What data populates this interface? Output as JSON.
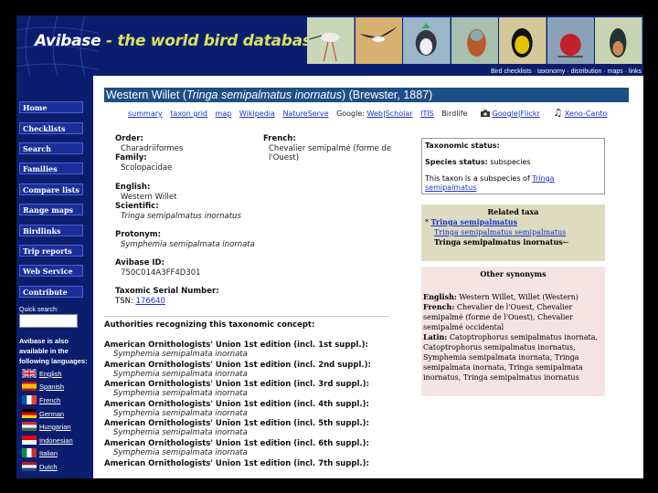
{
  "header": {
    "brand": "Avibase",
    "separator": " - ",
    "tagline": "the world bird database",
    "links": "Bird checklists · taxonomy · distribution · maps · links",
    "bird_colors": [
      "#c9d6b8",
      "#d8b070",
      "#9ab6c8",
      "#a8c0b0",
      "#d4c89a",
      "#8aa2b8",
      "#c8d4b0",
      "#b8c8d8"
    ]
  },
  "sidebar": {
    "nav": [
      "Home",
      "Checklists",
      "Search",
      "Families",
      "Compare lists",
      "Range maps",
      "Birdlinks",
      "Trip reports",
      "Web Service",
      "Contribute"
    ],
    "quick_search_label": "Quick search:",
    "quick_search_value": "",
    "available_text": "Avibase is also available in the following languages:",
    "languages": [
      {
        "name": "English",
        "flag": "uk"
      },
      {
        "name": "Spanish",
        "flag": "es"
      },
      {
        "name": "French",
        "flag": "fr"
      },
      {
        "name": "German",
        "flag": "de"
      },
      {
        "name": "Hungarian",
        "flag": "hu"
      },
      {
        "name": "Indonesian",
        "flag": "id"
      },
      {
        "name": "Italian",
        "flag": "it"
      },
      {
        "name": "Dutch",
        "flag": "nl"
      }
    ]
  },
  "title": {
    "prefix": "Western Willet (",
    "sci": "Tringa semipalmatus inornatus",
    "suffix": ") (Brewster, 1887)"
  },
  "tabs": {
    "summary": "summary",
    "taxon_grid": "taxon grid",
    "map": "map",
    "wikipedia": "Wikipedia",
    "natureserve": "NatureServe",
    "google_label": "Google:",
    "web": "Web",
    "pipe": "|",
    "scholar": "Scholar",
    "itis": "ITIS",
    "birdlife": "Birdlife",
    "google": "Google",
    "flickr": "Flickr",
    "xeno": "Xeno-Canto"
  },
  "info": {
    "order_label": "Order:",
    "order": "Charadriiformes",
    "family_label": "Family:",
    "family": "Scolopacidae",
    "english_label": "English:",
    "english": "Western Willet",
    "scientific_label": "Scientific:",
    "scientific": "Tringa semipalmatus inornatus",
    "protonym_label": "Protonym:",
    "protonym": "Symphemia semipalmata inornata",
    "avibase_id_label": "Avibase ID:",
    "avibase_id": "750C014A3FF4D301",
    "tsn_label": "Taxomic Serial Number:",
    "tsn_prefix": "TSN:",
    "tsn": "176640",
    "french_label": "French:",
    "french": "Chevalier semipalmé (forme de l'Ouest)"
  },
  "authorities": {
    "title": "Authorities recognizing this taxonomic concept:",
    "rows": [
      {
        "name": "American Ornithologists' Union 1st edition (incl. 1st suppl.):",
        "species": "Symphemia semipalmata inornata"
      },
      {
        "name": "American Ornithologists' Union 1st edition (incl. 2nd suppl.):",
        "species": "Symphemia semipalmata inornata"
      },
      {
        "name": "American Ornithologists' Union 1st edition (incl. 3rd suppl.):",
        "species": "Symphemia semipalmata inornata"
      },
      {
        "name": "American Ornithologists' Union 1st edition (incl. 4th suppl.):",
        "species": "Symphemia semipalmata inornata"
      },
      {
        "name": "American Ornithologists' Union 1st edition (incl. 5th suppl.):",
        "species": "Symphemia semipalmata inornata"
      },
      {
        "name": "American Ornithologists' Union 1st edition (incl. 6th suppl.):",
        "species": "Symphemia semipalmata inornata"
      },
      {
        "name": "American Ornithologists' Union 1st edition (incl. 7th suppl.):",
        "species": ""
      }
    ]
  },
  "taxonomic": {
    "status_label": "Taxonomic status:",
    "species_status_label": "Species status:",
    "species_status": "subspecies",
    "subspecies_text": "This taxon is a subspecies of ",
    "parent_link": "Tringa semipalmatus"
  },
  "related": {
    "title": "Related taxa",
    "bullet": "*",
    "item1": "Tringa semipalmatus",
    "item2": "Tringa semipalmatus semipalmatus",
    "item3": "Tringa semipalmatus inornatus",
    "arrow": "←"
  },
  "synonyms": {
    "title": "Other synonyms",
    "english_label": "English:",
    "english": "Western Willet, Willet (Western)",
    "french_label": "French:",
    "french": "Chevalier de l'Ouest, Chevalier semipalmé (forme de l'Ouest), Chevalier semipalmé occidental",
    "latin_label": "Latin:",
    "latin": "Catoptrophorus semipalmatus inornata, Catoptrophorus semipalmatus inornatus, Symphemia semipalmata inornata, Tringa semipalmata inornata, Tringa semipalmata inornatus, Tringa semipalmatus inornatus"
  }
}
